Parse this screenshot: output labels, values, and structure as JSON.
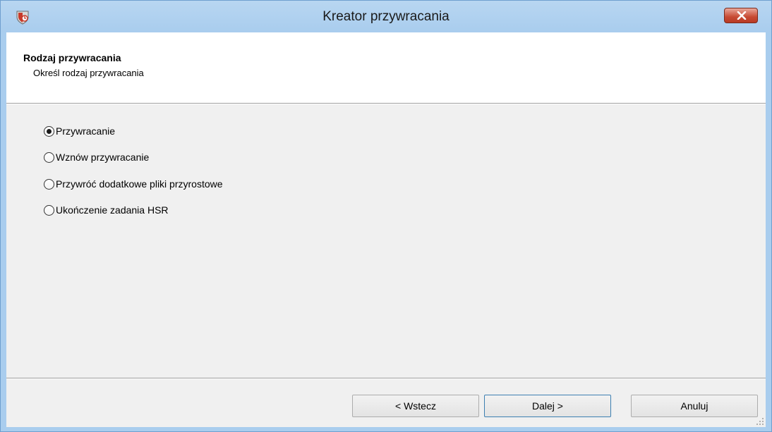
{
  "window": {
    "title": "Kreator przywracania",
    "accent": "#a9cdee",
    "close_color": "#c74a34"
  },
  "header": {
    "title": "Rodzaj przywracania",
    "subtitle": "Określ rodzaj przywracania"
  },
  "options": [
    {
      "label": "Przywracanie",
      "checked": true
    },
    {
      "label": "Wznów przywracanie",
      "checked": false
    },
    {
      "label": "Przywróć dodatkowe pliki przyrostowe",
      "checked": false
    },
    {
      "label": "Ukończenie zadania HSR",
      "checked": false
    }
  ],
  "buttons": {
    "back": "< Wstecz",
    "next": "Dalej >",
    "cancel": "Anuluj"
  },
  "icons": {
    "app": "shield-restore-icon",
    "close": "close-icon",
    "grip": "resize-grip-icon"
  }
}
